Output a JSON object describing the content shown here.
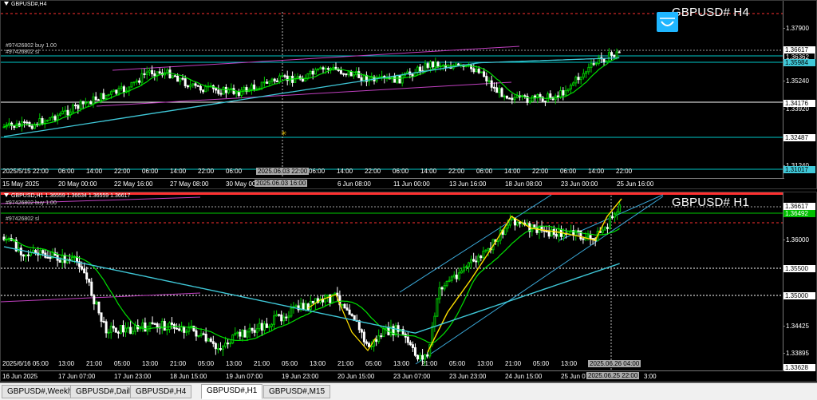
{
  "charts": {
    "h4": {
      "header": "GBPUSD#,H4",
      "symbol_label": "GBPUSD# H4",
      "order_buy_label": "#97426802 buy 1.00",
      "order_sl_label": "#97426802 sl",
      "trade_icon": "trade-panel-icon",
      "price_ticks": [
        "1.37900",
        "1.35240",
        "1.33920",
        "1.31240"
      ],
      "price_tags": [
        {
          "value": "1.36617",
          "style": "bid"
        },
        {
          "value": "1.36362",
          "style": "order"
        },
        {
          "value": "1.35984",
          "style": "cyan"
        },
        {
          "value": "1.34176",
          "style": "white"
        },
        {
          "value": "1.32487",
          "style": "white"
        },
        {
          "value": "1.31017",
          "style": "cyan"
        }
      ],
      "time_labels": [
        "2025/5/15 22:00",
        "06:00",
        "14:00",
        "22:00",
        "06:00",
        "14:00",
        "22:00",
        "06:00",
        "2025.06.03 22:00",
        "06:00",
        "14:00",
        "22:00",
        "06:00",
        "14:00",
        "22:00",
        "06:00",
        "14:00",
        "22:00",
        "06:00",
        "14:00",
        "22:00"
      ],
      "date_labels": [
        "15 May 2025",
        "20 May 00:00",
        "22 May 16:00",
        "27 May 08:00",
        "30 May 00:00",
        "2025.06.03 16:00",
        "6 Jun 08:00",
        "11 Jun 00:00",
        "13 Jun 16:00",
        "18 Jun 08:00",
        "23 Jun 00:00",
        "25 Jun 16:00"
      ],
      "crosshair_time_top": "2025.06.03 22:00",
      "crosshair_time_bottom": "2025.06.03 16:00"
    },
    "h1": {
      "header": "GBPUSD,H1 1.36559 1.36634 1.36559 1.36617",
      "symbol_label": "GBPUSD# H1",
      "order_buy_label": "#97426802 buy 1.00",
      "order_sl_label": "#97426802 sl",
      "price_ticks": [
        "1.36000",
        "1.35500",
        "1.35000",
        "1.34425",
        "1.33895",
        "1.33628"
      ],
      "price_tags": [
        {
          "value": "1.36617",
          "style": "bid"
        },
        {
          "value": "1.36492",
          "style": "green"
        },
        {
          "value": "1.35500",
          "style": "white"
        },
        {
          "value": "1.35000",
          "style": "white"
        },
        {
          "value": "1.33628",
          "style": "white"
        }
      ],
      "time_labels": [
        "2025/6/16 05:00",
        "13:00",
        "21:00",
        "05:00",
        "13:00",
        "21:00",
        "05:00",
        "13:00",
        "21:00",
        "05:00",
        "13:00",
        "21:00",
        "05:00",
        "13:00",
        "21:00",
        "05:00",
        "13:00",
        "21:00",
        "05:00",
        "13:00",
        "2025.06.26 04:00"
      ],
      "date_labels": [
        "16 Jun 2025",
        "17 Jun 07:00",
        "17 Jun 23:00",
        "18 Jun 15:00",
        "19 Jun 07:00",
        "19 Jun 23:00",
        "20 Jun 15:00",
        "23 Jun 07:00",
        "23 Jun 23:00",
        "24 Jun 15:00",
        "25 Jun 07",
        "2025.06.25 22:00",
        "3:00"
      ]
    }
  },
  "tabs": [
    {
      "label": "GBPUSD#,Weekly",
      "active": false
    },
    {
      "label": "GBPUSD#,Daily",
      "active": false
    },
    {
      "label": "GBPUSD#,H4",
      "active": false
    },
    {
      "label": "GBPUSD#,H1",
      "active": true
    },
    {
      "label": "GBPUSD#,M15",
      "active": false
    }
  ],
  "colors": {
    "background": "#000000",
    "bull_candle": "#00c800",
    "bear_candle": "#ffffff",
    "ma_fast": "#00e000",
    "ma_slow": "#3fc8d8",
    "ma_yellow": "#ffe000",
    "trendline": "#c040c0",
    "order_line": "#00c8c8",
    "bid_line": "#ff3030"
  }
}
